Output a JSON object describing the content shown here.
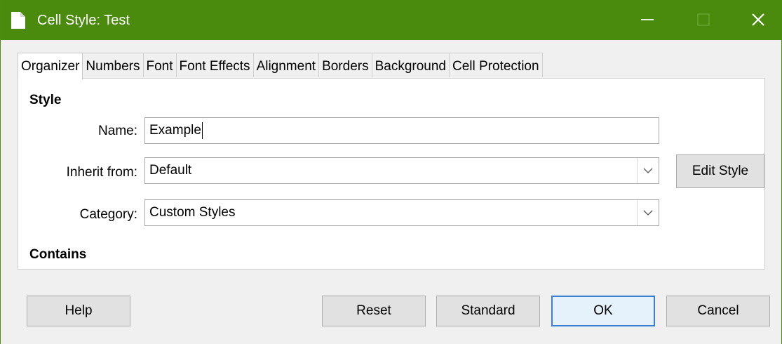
{
  "window": {
    "title": "Cell Style: Test",
    "accent_color": "#4a8a0c",
    "icons": [
      "document-icon",
      "minimize-icon",
      "maximize-icon",
      "close-icon"
    ]
  },
  "tabs": [
    {
      "label": "Organizer",
      "active": true
    },
    {
      "label": "Numbers"
    },
    {
      "label": "Font"
    },
    {
      "label": "Font Effects"
    },
    {
      "label": "Alignment"
    },
    {
      "label": "Borders"
    },
    {
      "label": "Background"
    },
    {
      "label": "Cell Protection"
    }
  ],
  "style_section": {
    "heading": "Style",
    "name_label": "Name:",
    "name_value": "Example",
    "inherit_label": "Inherit from:",
    "inherit_value": "Default",
    "category_label": "Category:",
    "category_value": "Custom Styles",
    "edit_style_label": "Edit Style"
  },
  "contains_section": {
    "heading": "Contains"
  },
  "buttons": {
    "help": "Help",
    "reset": "Reset",
    "standard": "Standard",
    "ok": "OK",
    "cancel": "Cancel"
  }
}
